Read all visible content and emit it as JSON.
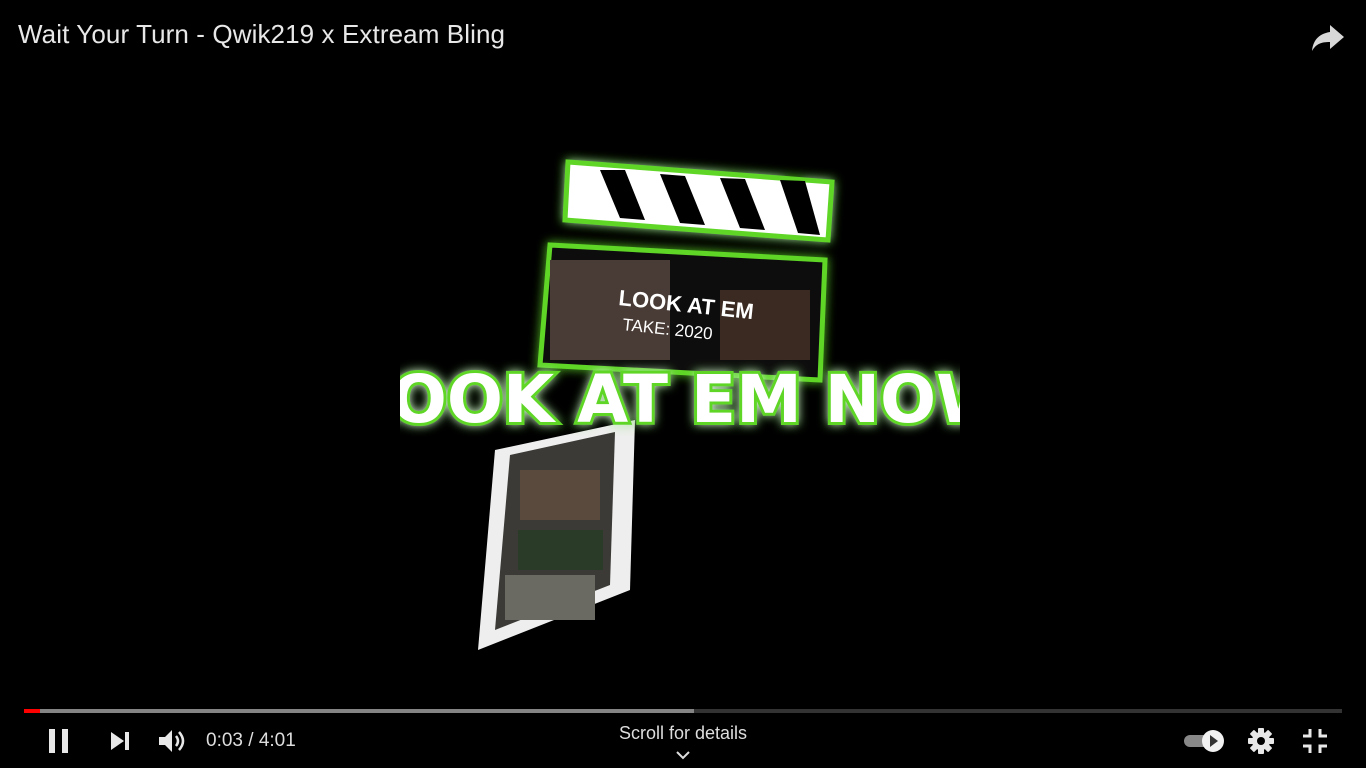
{
  "video": {
    "title": "Wait Your Turn - Qwik219 x Extream Bling",
    "artwork_text": {
      "clapper_line1": "LOOK AT EM",
      "clapper_line2": "TAKE: 2020",
      "logo": "LOOK AT EM NOW"
    }
  },
  "player": {
    "current_time": "0:03",
    "time_separator": "/",
    "duration": "4:01",
    "played_fraction": 0.0124,
    "buffered_fraction": 0.508,
    "scroll_hint": "Scroll for details",
    "autoplay_enabled": true
  },
  "icons": {
    "share": "share-icon",
    "pause": "pause-icon",
    "next": "next-icon",
    "volume": "volume-icon",
    "chevron": "chevron-down-icon",
    "autoplay": "autoplay-toggle-icon",
    "settings": "gear-icon",
    "fullscreen_exit": "exit-fullscreen-icon"
  },
  "colors": {
    "progress_played": "#ff0000",
    "logo_green": "#5ed627",
    "background": "#000000"
  }
}
